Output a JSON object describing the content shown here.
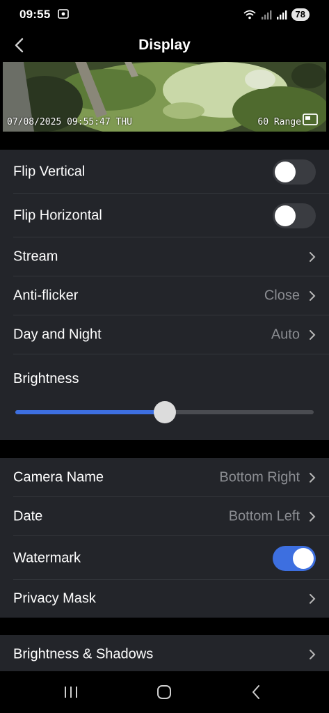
{
  "status": {
    "time": "09:55",
    "battery": "78"
  },
  "header": {
    "title": "Display"
  },
  "preview": {
    "osd_date": "07/08/2025 09:55:47 THU",
    "osd_name": "60 Range"
  },
  "settings": {
    "flip_vertical": {
      "label": "Flip Vertical",
      "on": false
    },
    "flip_horizontal": {
      "label": "Flip Horizontal",
      "on": false
    },
    "stream": {
      "label": "Stream"
    },
    "anti_flicker": {
      "label": "Anti-flicker",
      "value": "Close"
    },
    "day_night": {
      "label": "Day and Night",
      "value": "Auto"
    },
    "brightness": {
      "label": "Brightness",
      "level_percent": 50
    }
  },
  "osd": {
    "camera_name": {
      "label": "Camera Name",
      "value": "Bottom Right"
    },
    "date": {
      "label": "Date",
      "value": "Bottom Left"
    },
    "watermark": {
      "label": "Watermark",
      "on": true
    },
    "privacy_mask": {
      "label": "Privacy Mask"
    }
  },
  "advanced": {
    "brightness_shadows": {
      "label": "Brightness & Shadows"
    }
  },
  "colors": {
    "accent": "#3d6fe0",
    "background": "#000000",
    "row_bg": "#23252a",
    "muted_text": "#8b8d92"
  }
}
